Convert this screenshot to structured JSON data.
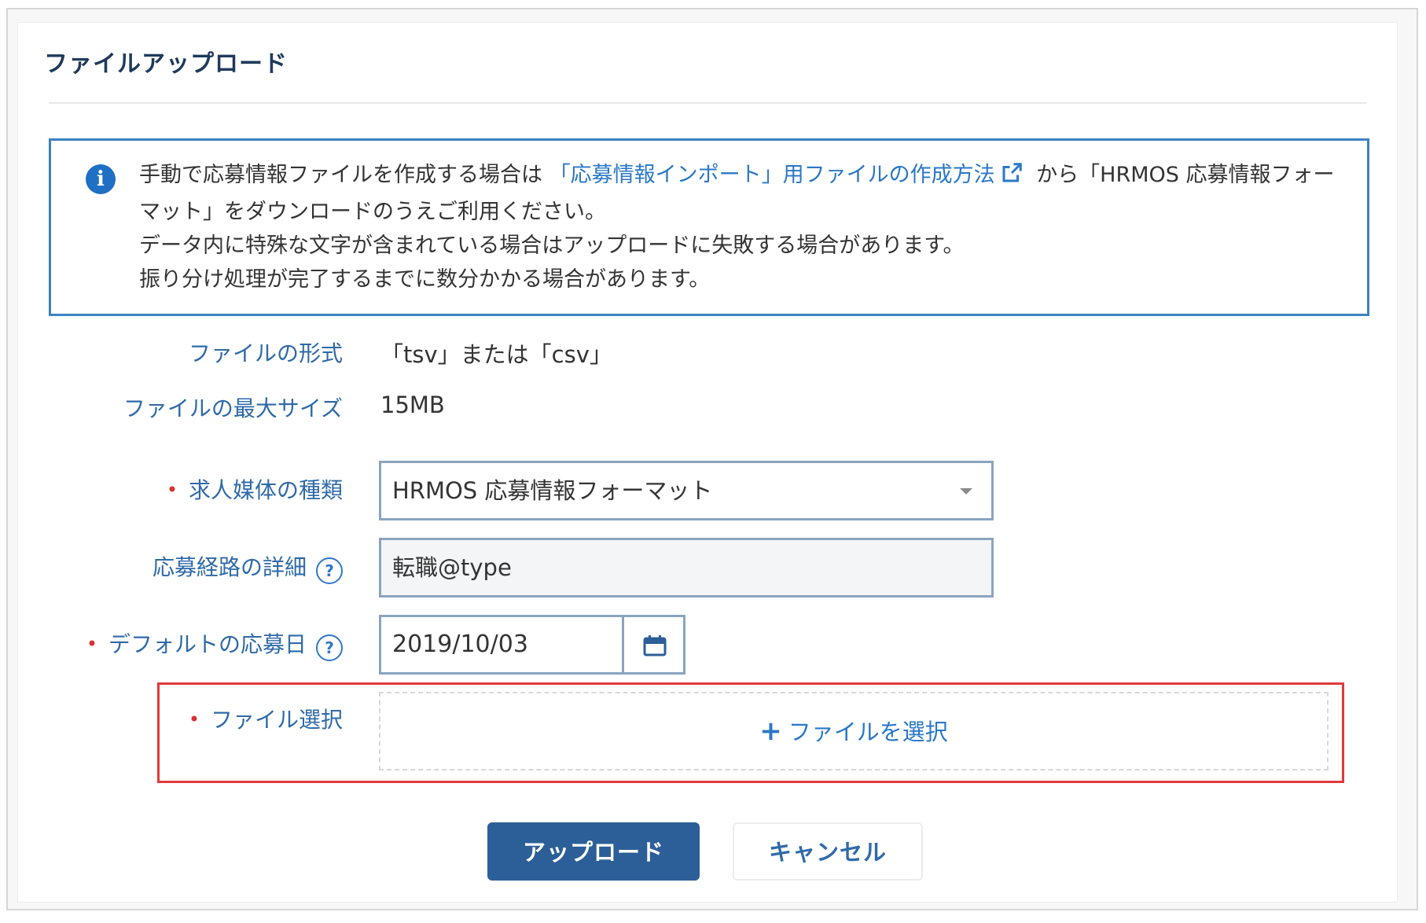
{
  "page": {
    "title": "ファイルアップロード"
  },
  "info": {
    "icon": "info-icon",
    "line1_prefix": "手動で応募情報ファイルを作成する場合は",
    "link_text": "「応募情報インポート」用ファイルの作成方法",
    "line1_suffix": "から「HRMOS 応募情報フォーマット」をダウンロードのうえご利用ください。",
    "line2": "データ内に特殊な文字が含まれている場合はアップロードに失敗する場合があります。",
    "line3": "振り分け処理が完了するまでに数分かかる場合があります。"
  },
  "form": {
    "file_format": {
      "label": "ファイルの形式",
      "value": "「tsv」または「csv」"
    },
    "max_size": {
      "label": "ファイルの最大サイズ",
      "value": "15MB"
    },
    "media_type": {
      "required_mark": "•",
      "label": "求人媒体の種類",
      "selected": "HRMOS 応募情報フォーマット"
    },
    "route_detail": {
      "label": "応募経路の詳細",
      "help": "?",
      "value": "転職@type"
    },
    "default_date": {
      "required_mark": "•",
      "label": "デフォルトの応募日",
      "help": "?",
      "value": "2019/10/03"
    },
    "file_select": {
      "required_mark": "•",
      "label": "ファイル選択",
      "button_label": "ファイルを選択"
    }
  },
  "actions": {
    "upload": "アップロード",
    "cancel": "キャンセル"
  },
  "colors": {
    "accent_blue": "#2a78c8",
    "primary_button": "#2c5f97",
    "highlight_red": "#e03a3a",
    "required_red": "#d93030"
  }
}
